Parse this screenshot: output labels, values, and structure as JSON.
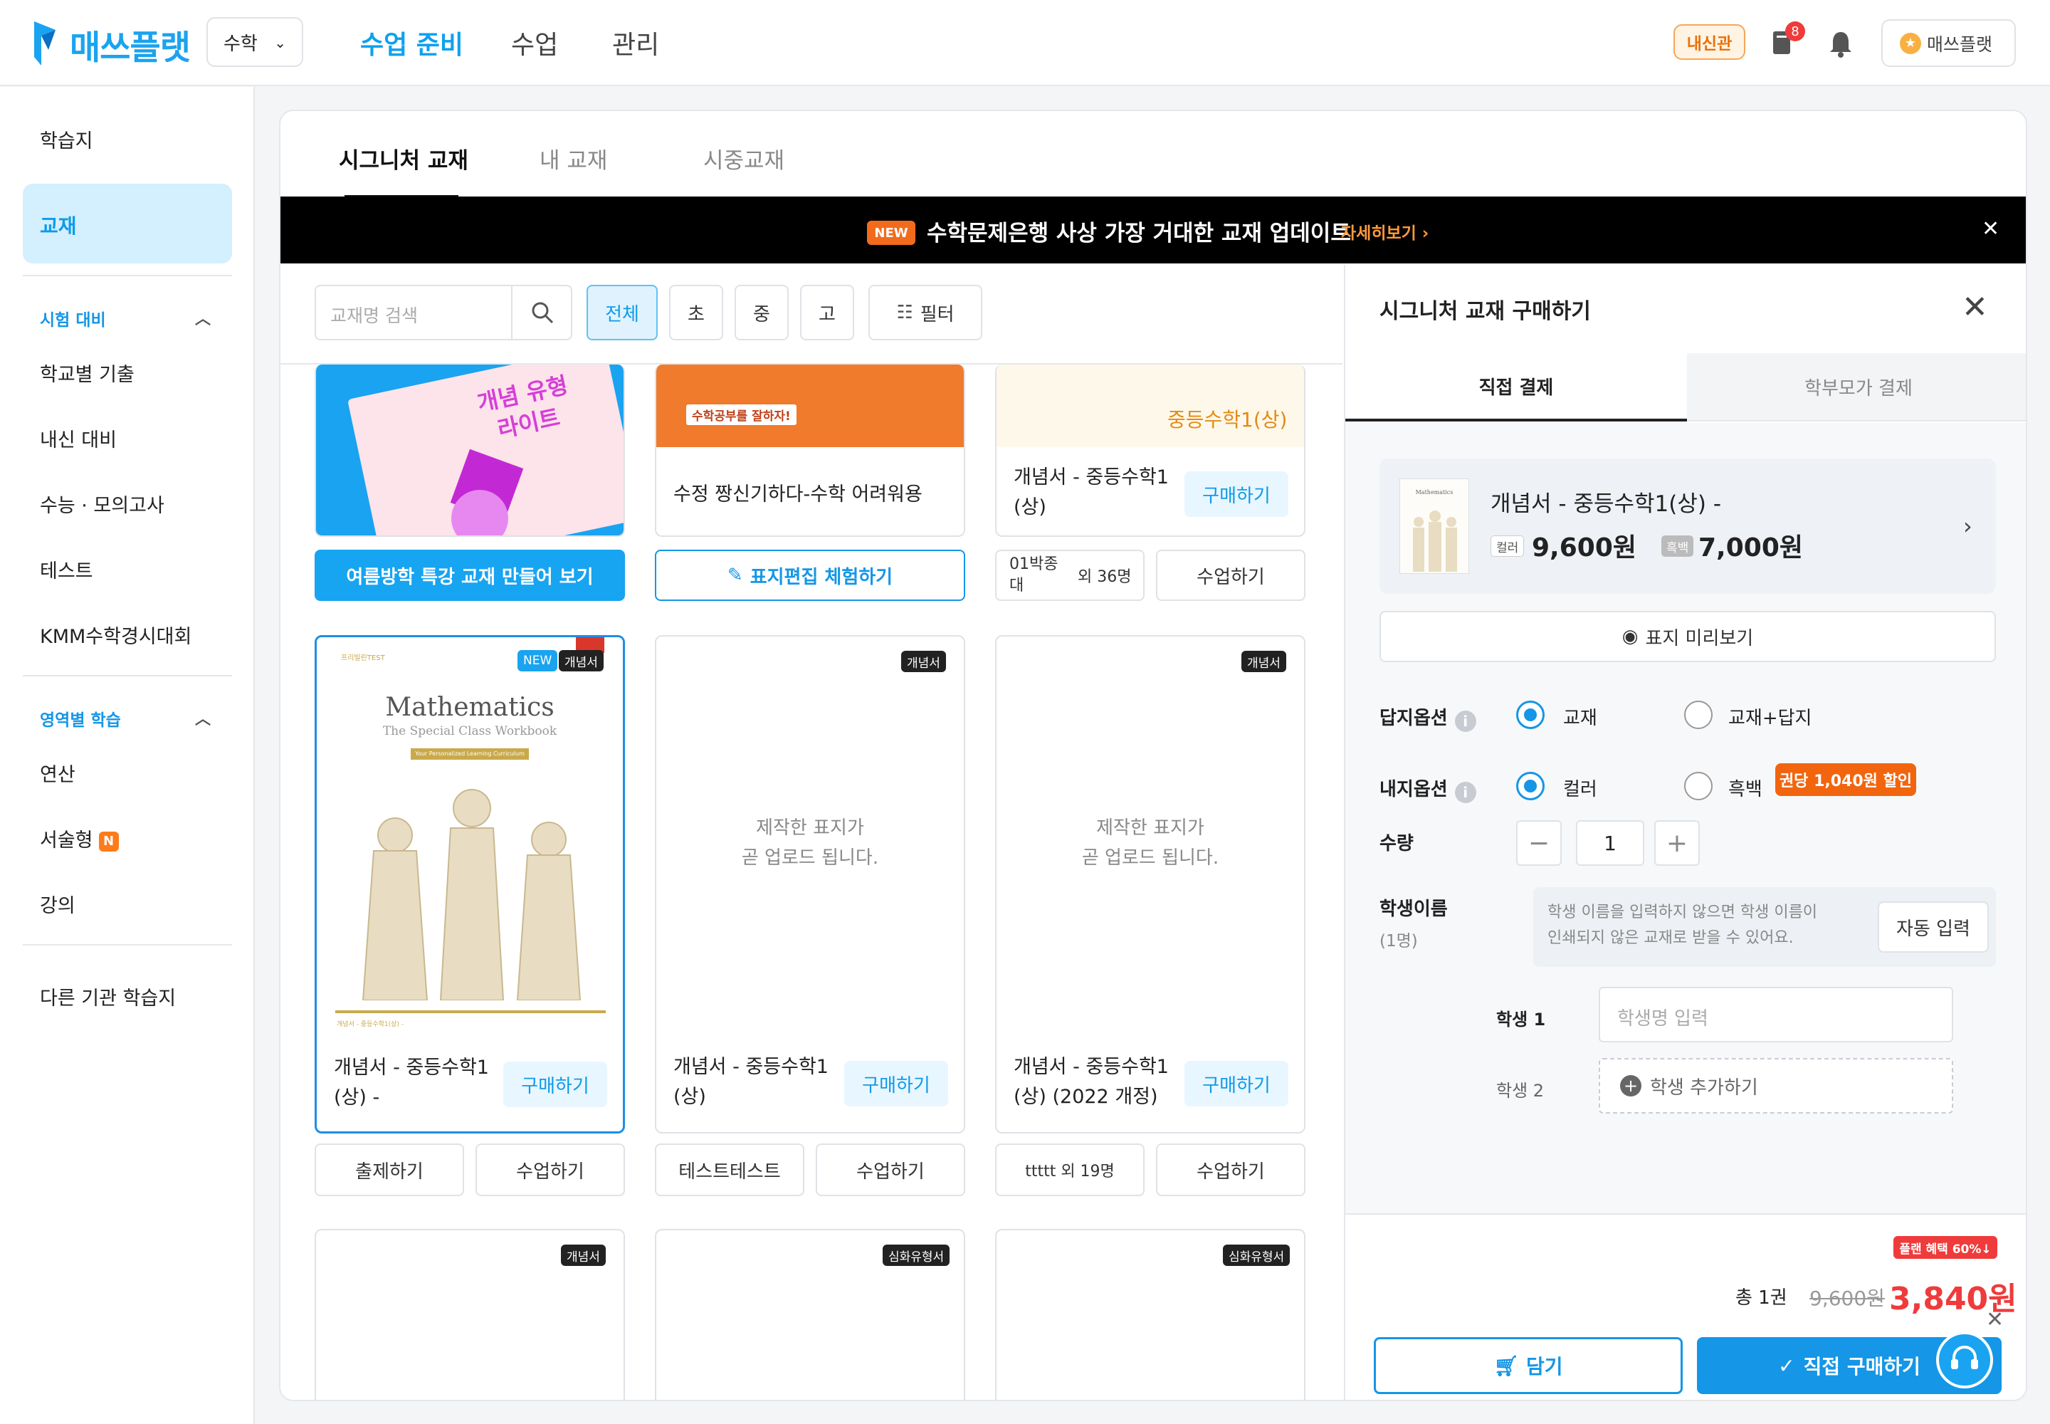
{
  "app": {
    "logo_text": "매쓰플랫",
    "subject": "수학"
  },
  "nav": {
    "items": [
      "수업 준비",
      "수업",
      "관리"
    ],
    "badge_label": "내신관",
    "notif_count": "8",
    "user_name": "매쓰플랫",
    "user_icon": "★"
  },
  "sidebar": {
    "worksheet": "학습지",
    "textbook": "교재",
    "section1": {
      "title": "시험 대비",
      "items": [
        "학교별 기출",
        "내신 대비",
        "수능 · 모의고사",
        "테스트",
        "KMM수학경시대회"
      ]
    },
    "section2": {
      "title": "영역별 학습",
      "items": [
        "연산",
        "서술형",
        "강의"
      ],
      "new_badge": "N"
    },
    "other": "다른 기관 학습지"
  },
  "tabs": [
    "시그니처 교재",
    "내 교재",
    "시중교재"
  ],
  "banner": {
    "new": "NEW",
    "message": "수학문제은행 사상 가장 거대한 교재 업데이트",
    "more": "자세히보기 ›",
    "close": "✕"
  },
  "filters": {
    "search_placeholder": "교재명 검색",
    "chips": [
      "전체",
      "초",
      "중",
      "고"
    ],
    "filter_label": "필터"
  },
  "cards_top": {
    "card1": {
      "cover_text": "개념 유형\n라이트",
      "action": "여름방학 특강 교재 만들어 보기"
    },
    "card2": {
      "cover_sticker": "수학공부를 잘하자!",
      "title": "수정 짱신기하다-수학 어려워용",
      "action": "표지편집 체험하기"
    },
    "card3": {
      "cover_text": "중등수학1(상)",
      "title": "개념서 - 중등수학1 (상)",
      "buy": "구매하기",
      "btn_left": "01박종대",
      "btn_left_sub": "외 36명",
      "btn_right": "수업하기"
    }
  },
  "cards_mid": [
    {
      "tags": [
        "NEW",
        "개념서"
      ],
      "cover_sub_top": "프리빌린TEST",
      "cover_title": "Mathematics",
      "cover_subtitle": "The Special Class Workbook",
      "cover_band": "Your Personalized Learning Curriculum",
      "cover_footer": "개념서 - 중등수학1(상) -",
      "title": "개념서 - 중등수학1 (상) -",
      "buy": "구매하기",
      "btn_left": "출제하기",
      "btn_right": "수업하기"
    },
    {
      "tags": [
        "개념서"
      ],
      "placeholder": "제작한 표지가\n곧 업로드 됩니다.",
      "title": "개념서 - 중등수학1 (상)",
      "buy": "구매하기",
      "btn_left": "테스트테스트",
      "btn_right": "수업하기"
    },
    {
      "tags": [
        "개념서"
      ],
      "placeholder": "제작한 표지가\n곧 업로드 됩니다.",
      "title": "개념서 - 중등수학1 (상) (2022 개정)",
      "buy": "구매하기",
      "btn_left": "ttttt 외 19명",
      "btn_right": "수업하기"
    }
  ],
  "cards_bottom_tags": [
    "개념서",
    "심화유형서",
    "심화유형서"
  ],
  "purchase": {
    "title": "시그니처 교재 구매하기",
    "tabs": [
      "직접 결제",
      "학부모가 결제"
    ],
    "product": {
      "name": "개념서 - 중등수학1(상) -",
      "color_label": "컬러",
      "color_price": "9,600원",
      "bw_label": "흑백",
      "bw_price": "7,000원",
      "thumb_title": "Mathematics"
    },
    "preview": "표지 미리보기",
    "answer_option": {
      "label": "답지옵션",
      "opt1": "교재",
      "opt2": "교재+답지"
    },
    "paper_option": {
      "label": "내지옵션",
      "opt1": "컬러",
      "opt2": "흑백",
      "discount": "권당 1,040원 할인"
    },
    "quantity": {
      "label": "수량",
      "value": "1",
      "minus": "−",
      "plus": "+"
    },
    "student": {
      "label": "학생이름",
      "count": "(1명)",
      "note": "학생 이름을 입력하지 않으면 학생 이름이\n인쇄되지 않은 교재로 받을 수 있어요.",
      "auto": "자동 입력",
      "s1_label": "학생 1",
      "s1_placeholder": "학생명 입력",
      "s2_label": "학생 2",
      "add": "학생 추가하기"
    },
    "footer": {
      "plan_badge": "플랜 혜택 60%↓",
      "total": "총 1권",
      "original": "9,600원",
      "final": "3,840원",
      "cart": "담기",
      "buy": "직접 구매하기"
    }
  },
  "colors": {
    "accent": "#1596e6",
    "brand": "#1aa3f0",
    "danger": "#ef3b3b",
    "orange": "#f26b1d"
  }
}
